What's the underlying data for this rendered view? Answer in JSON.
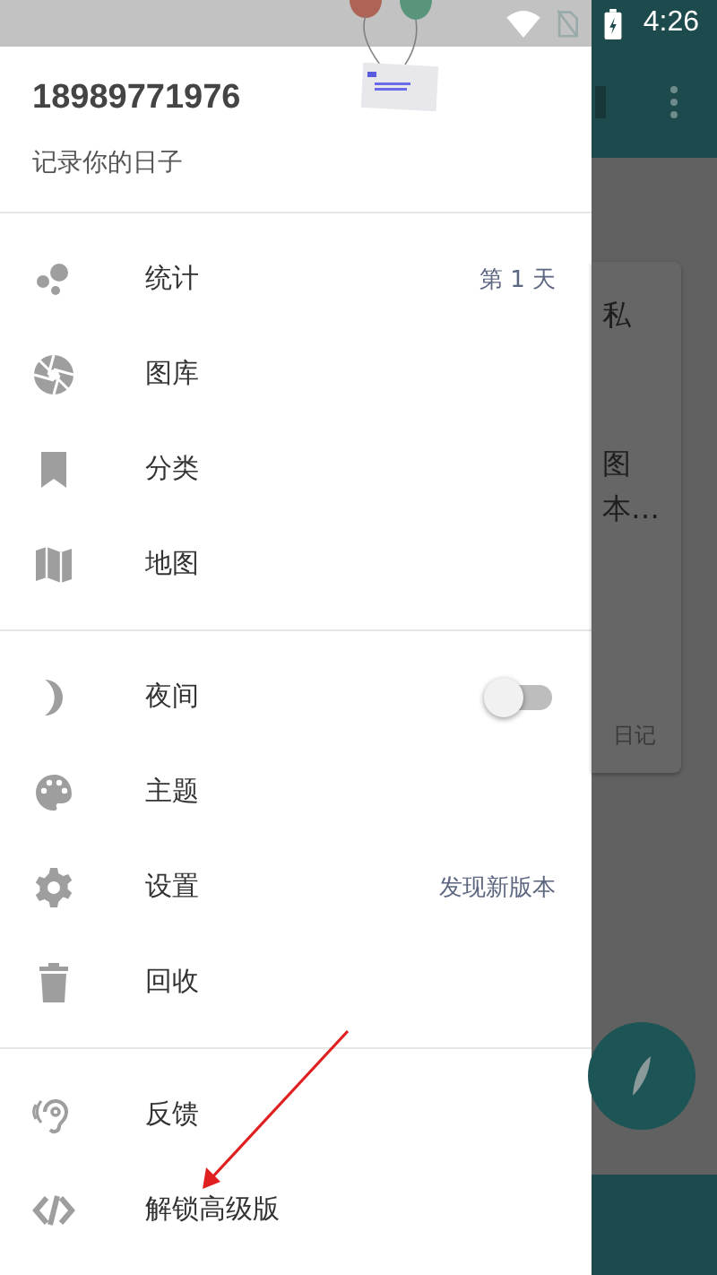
{
  "status_bar": {
    "time": "4:26"
  },
  "drawer": {
    "account": "18989771976",
    "tagline": "记录你的日子",
    "sections": [
      [
        {
          "label": "统计",
          "kind": "note",
          "note": "第 1 天"
        },
        {
          "label": "图库",
          "kind": "plain"
        },
        {
          "label": "分类",
          "kind": "plain"
        },
        {
          "label": "地图",
          "kind": "plain"
        }
      ],
      [
        {
          "label": "夜间",
          "kind": "toggle",
          "on": false
        },
        {
          "label": "主题",
          "kind": "plain"
        },
        {
          "label": "设置",
          "kind": "note",
          "note": "发现新版本"
        },
        {
          "label": "回收",
          "kind": "plain"
        }
      ],
      [
        {
          "label": "反馈",
          "kind": "plain"
        },
        {
          "label": "解锁高级版",
          "kind": "plain"
        }
      ]
    ]
  },
  "background": {
    "card_lines": [
      "私",
      "图",
      "本…"
    ],
    "card_tag": "日记"
  }
}
